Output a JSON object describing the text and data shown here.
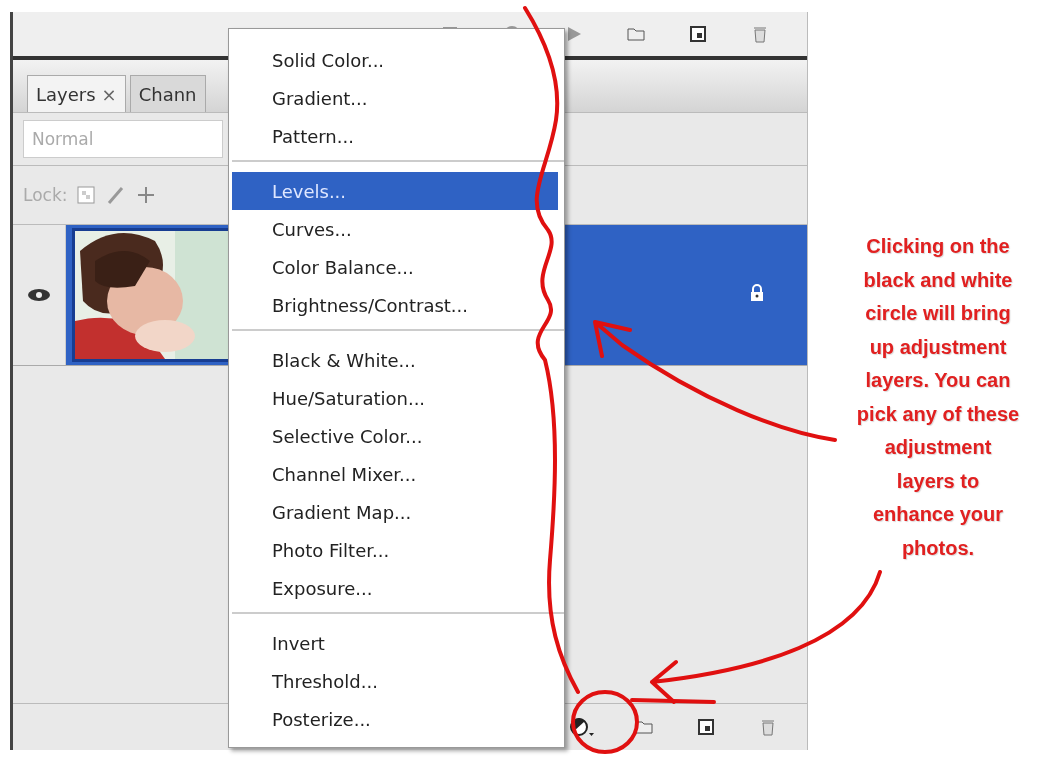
{
  "tabs": [
    {
      "label": "Layers",
      "close": "×",
      "selected": true
    },
    {
      "label": "Chann",
      "selected": false
    }
  ],
  "blend_mode": {
    "value": "Normal"
  },
  "lock": {
    "label": "Lock:"
  },
  "layers": [
    {
      "kind": "picture",
      "selected": true,
      "visible": true,
      "locked": true
    }
  ],
  "menu": {
    "sections": [
      [
        {
          "label": "Solid Color...",
          "selected": false
        },
        {
          "label": "Gradient...",
          "selected": false
        },
        {
          "label": "Pattern...",
          "selected": false
        }
      ],
      [
        {
          "label": "Levels...",
          "selected": true
        },
        {
          "label": "Curves...",
          "selected": false
        },
        {
          "label": "Color Balance...",
          "selected": false
        },
        {
          "label": "Brightness/Contrast...",
          "selected": false
        }
      ],
      [
        {
          "label": "Black & White...",
          "selected": false
        },
        {
          "label": "Hue/Saturation...",
          "selected": false
        },
        {
          "label": "Selective Color...",
          "selected": false
        },
        {
          "label": "Channel Mixer...",
          "selected": false
        },
        {
          "label": "Gradient Map...",
          "selected": false
        },
        {
          "label": "Photo Filter...",
          "selected": false
        },
        {
          "label": "Exposure...",
          "selected": false
        }
      ],
      [
        {
          "label": "Invert",
          "selected": false
        },
        {
          "label": "Threshold...",
          "selected": false
        },
        {
          "label": "Posterize...",
          "selected": false
        }
      ]
    ]
  },
  "annotation": {
    "lines": [
      "Clicking on the",
      "black and white",
      "circle will bring",
      "up adjustment",
      "layers.  You can",
      "pick any of these",
      "adjustment",
      "layers to",
      "enhance your",
      "photos."
    ]
  }
}
